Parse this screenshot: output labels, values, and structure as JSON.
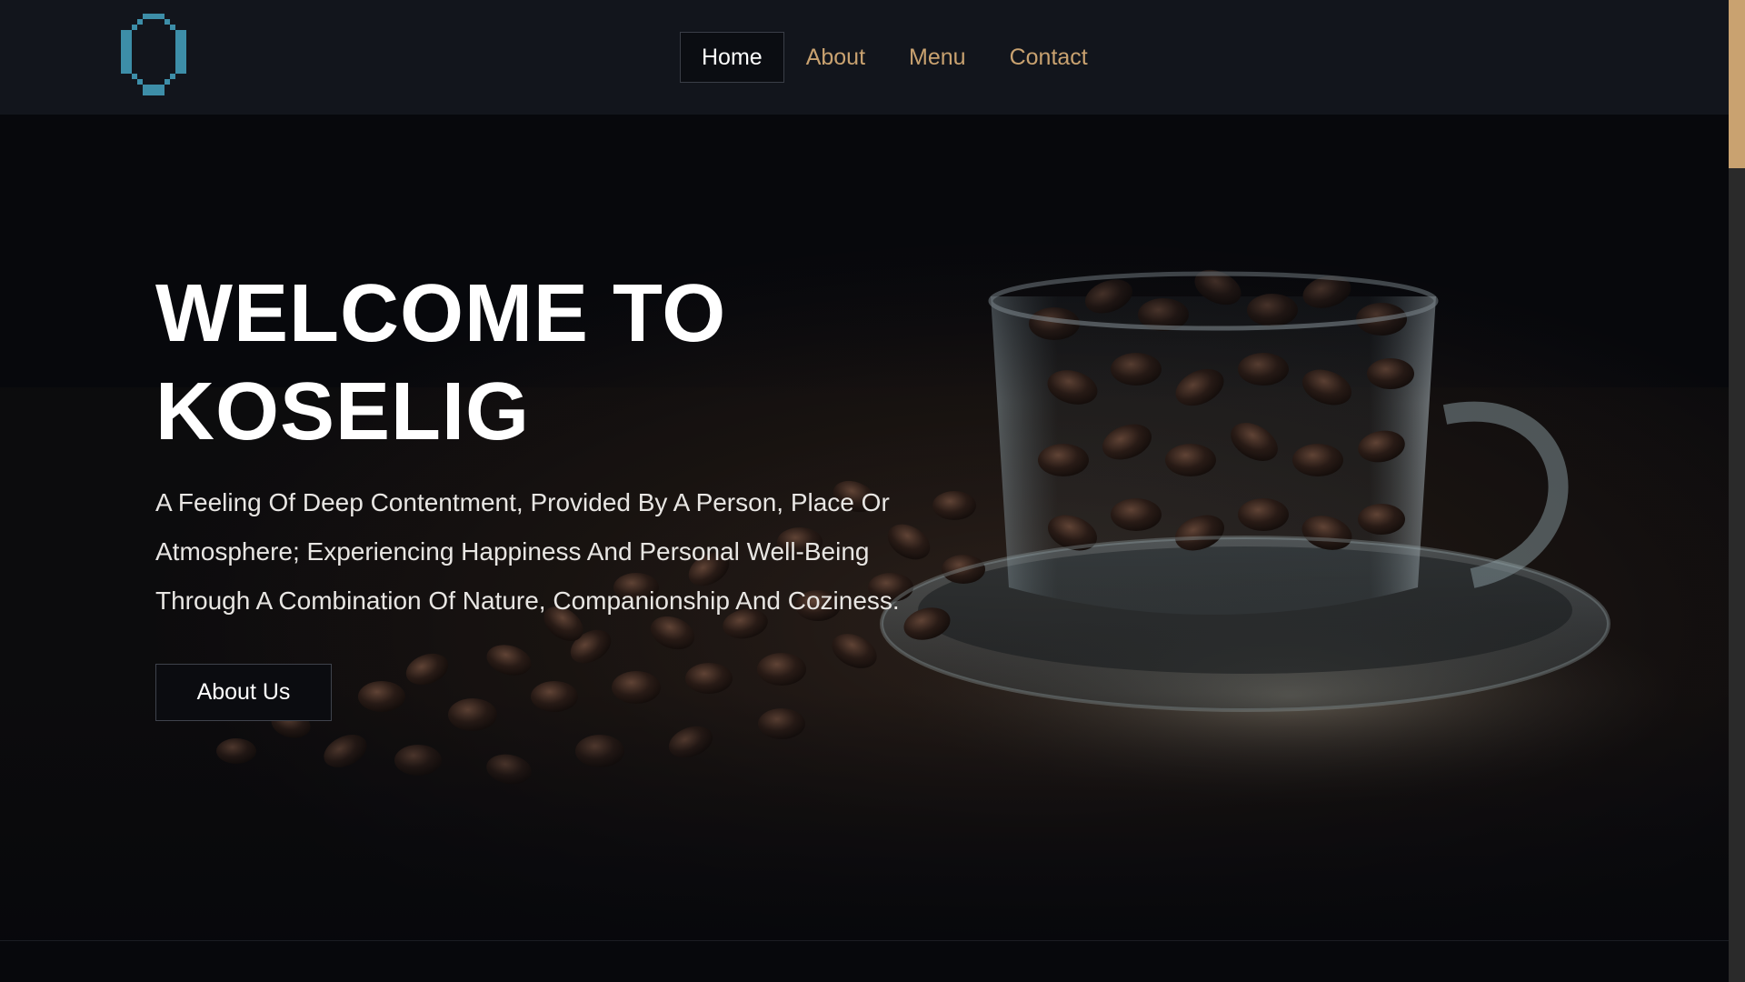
{
  "nav": {
    "items": [
      {
        "label": "Home",
        "active": true
      },
      {
        "label": "About",
        "active": false
      },
      {
        "label": "Menu",
        "active": false
      },
      {
        "label": "Contact",
        "active": false
      }
    ]
  },
  "hero": {
    "title": "WELCOME TO KOSELIG",
    "subtitle": "A Feeling Of Deep Contentment, Provided By A Person, Place Or Atmosphere; Experiencing Happiness And Personal Well-Being Through A Combination Of Nature, Companionship And Coziness.",
    "button_label": "About Us"
  },
  "back_to_top": {
    "icon": "chevron-up-icon",
    "glyph": "⌃"
  },
  "colors": {
    "accent": "#c9a270",
    "logo": "#3d8ea8",
    "header_bg": "#12151c",
    "page_bg": "#07080c"
  },
  "logo": {
    "icon": "pixel-ring-logo"
  }
}
